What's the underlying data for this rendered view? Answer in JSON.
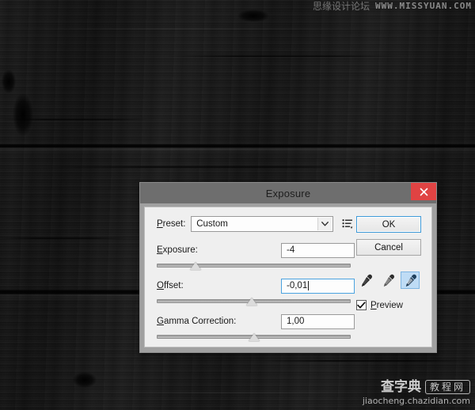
{
  "background": {
    "description": "dark wood plank texture",
    "base_color": "#161616"
  },
  "watermarks": {
    "top": {
      "cn_text": "思缘设计论坛",
      "url": "WWW.MISSYUAN.COM"
    },
    "bottom": {
      "brand": "查字典",
      "badge": "教程网",
      "url": "jiaocheng.chazidian.com"
    }
  },
  "dialog": {
    "title": "Exposure",
    "close_icon": "close-icon",
    "preset": {
      "label_prefix": "P",
      "label_rest": "reset:",
      "value": "Custom",
      "chevron_icon": "chevron-down-icon",
      "menu_icon": "preset-options-icon"
    },
    "sliders": [
      {
        "key": "exposure",
        "label_prefix": "E",
        "label_rest": "xposure:",
        "value": "-4",
        "thumb_percent": 20,
        "focused": false
      },
      {
        "key": "offset",
        "label_prefix": "O",
        "label_rest": "ffset:",
        "value": "-0,01",
        "thumb_percent": 49,
        "focused": true
      },
      {
        "key": "gamma",
        "label_prefix": "G",
        "label_rest": "amma Correction:",
        "value": "1,00",
        "thumb_percent": 50,
        "focused": false
      }
    ],
    "buttons": {
      "ok": "OK",
      "cancel": "Cancel"
    },
    "eyedroppers": [
      {
        "name": "eyedropper-black-point-icon",
        "active": false
      },
      {
        "name": "eyedropper-gray-point-icon",
        "active": false
      },
      {
        "name": "eyedropper-white-point-icon",
        "active": true
      }
    ],
    "preview": {
      "label_prefix": "P",
      "label_rest": "review",
      "checked": true,
      "check_icon": "checkmark-icon"
    },
    "colors": {
      "titlebar": "#6e6e6e",
      "body": "#efefef",
      "close": "#e04343",
      "focus_blue": "#4aa3e0",
      "dropper_active": "#bfdcf5"
    }
  }
}
